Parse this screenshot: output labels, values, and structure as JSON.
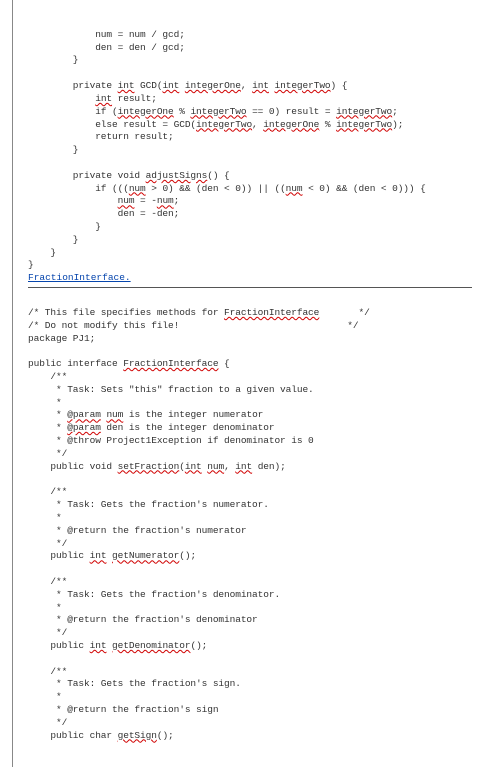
{
  "top_code": {
    "l1": "            num = num / gcd;",
    "l2": "            den = den / gcd;",
    "l3": "        }",
    "l4": "",
    "l5a": "        private ",
    "l5b": "int",
    "l5c": " GCD(",
    "l5d": "int",
    "l5e": " ",
    "l5f": "integerOne",
    "l5g": ", ",
    "l5h": "int",
    "l5i": " ",
    "l5j": "integerTwo",
    "l5k": ") {",
    "l6a": "            ",
    "l6b": "int",
    "l6c": " result;",
    "l7a": "            if (",
    "l7b": "integerOne",
    "l7c": " % ",
    "l7d": "integerTwo",
    "l7e": " == 0) result = ",
    "l7f": "integerTwo",
    "l7g": ";",
    "l8a": "            else result = GCD(",
    "l8b": "integerTwo",
    "l8c": ", ",
    "l8d": "integerOne",
    "l8e": " % ",
    "l8f": "integerTwo",
    "l8g": ");",
    "l9": "            return result;",
    "l10": "        }",
    "l11": "",
    "l12a": "        private void ",
    "l12b": "adjustSigns",
    "l12c": "() {",
    "l13a": "            if (((",
    "l13b": "num",
    "l13c": " > 0) && (den < 0)) || ((",
    "l13d": "num",
    "l13e": " < 0) && (den < 0))) {",
    "l14a": "                ",
    "l14b": "num",
    "l14c": " = -",
    "l14d": "num",
    "l14e": ";",
    "l15": "                den = -den;",
    "l16": "            }",
    "l17": "        }",
    "l18": "    }",
    "l19": "}"
  },
  "link_label": "FractionInterface.",
  "bottom_code": {
    "c1a": "/* This file specifies methods for ",
    "c1b": "FractionInterface",
    "c1c": "       */",
    "c2": "/* Do not modify this file!                              */",
    "c3": "package PJ1;",
    "c4": "",
    "c5a": "public interface ",
    "c5b": "FractionInterface",
    "c5c": " {",
    "c6": "    /**",
    "c7": "     * Task: Sets \"this\" fraction to a given value.",
    "c8": "     *",
    "c9a": "     * ",
    "c9b": "@param",
    "c9c": " ",
    "c9d": "num",
    "c9e": " is the integer numerator",
    "c10a": "     * ",
    "c10b": "@param",
    "c10c": " den is the integer denominator",
    "c11": "     * @throw Project1Exception if denominator is 0",
    "c12": "     */",
    "c13a": "    public void ",
    "c13b": "setFraction",
    "c13c": "(",
    "c13d": "int",
    "c13e": " ",
    "c13f": "num",
    "c13g": ", ",
    "c13h": "int",
    "c13i": " den);",
    "c14": "",
    "c15": "    /**",
    "c16": "     * Task: Gets the fraction's numerator.",
    "c17": "     *",
    "c18": "     * @return the fraction's numerator",
    "c19": "     */",
    "c20a": "    public ",
    "c20b": "int",
    "c20c": " ",
    "c20d": "getNumerator",
    "c20e": "();",
    "c21": "",
    "c22": "    /**",
    "c23": "     * Task: Gets the fraction's denominator.",
    "c24": "     *",
    "c25": "     * @return the fraction's denominator",
    "c26": "     */",
    "c27a": "    public ",
    "c27b": "int",
    "c27c": " ",
    "c27d": "getDenominator",
    "c27e": "();",
    "c28": "",
    "c29": "    /**",
    "c30": "     * Task: Gets the fraction's sign.",
    "c31": "     *",
    "c32": "     * @return the fraction's sign",
    "c33": "     */",
    "c34a": "    public char ",
    "c34b": "getSign",
    "c34c": "();"
  }
}
